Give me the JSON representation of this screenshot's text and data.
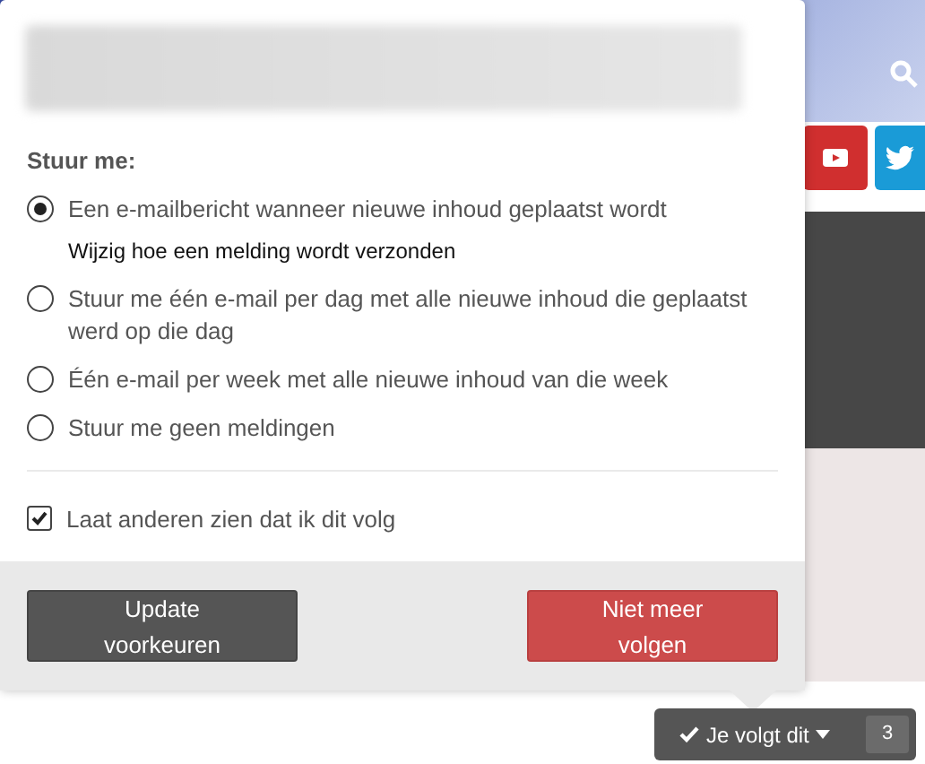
{
  "popup": {
    "heading": "Stuur me:",
    "options": [
      {
        "label": "Een e-mailbericht wanneer nieuwe inhoud geplaatst wordt",
        "selected": true,
        "link": "Wijzig hoe een melding wordt verzonden"
      },
      {
        "label": "Stuur me één e-mail per dag met alle nieuwe inhoud die geplaatst werd op die dag",
        "selected": false
      },
      {
        "label": "Één e-mail per week met alle nieuwe inhoud van die week",
        "selected": false
      },
      {
        "label": "Stuur me geen meldingen",
        "selected": false
      }
    ],
    "visibility": {
      "label": "Laat anderen zien dat ik dit volg",
      "checked": true
    },
    "buttons": [
      {
        "label": "Update voorkeuren",
        "kind": "secondary"
      },
      {
        "label": "Niet meer volgen",
        "kind": "danger"
      }
    ]
  },
  "follow_button": {
    "label": "Je volgt dit",
    "count": "3"
  }
}
